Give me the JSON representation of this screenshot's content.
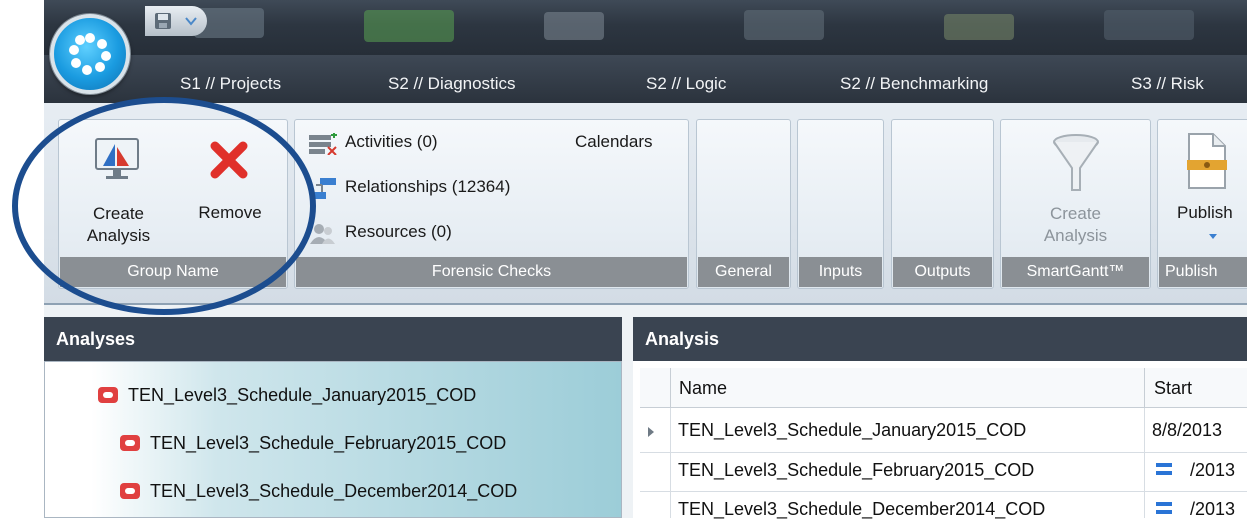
{
  "tabs": [
    "S1 // Projects",
    "S2 // Diagnostics",
    "S2 // Logic",
    "S2 // Benchmarking",
    "S3 // Risk"
  ],
  "ribbon": {
    "group_name": {
      "create_label": "Create\nAnalysis",
      "remove_label": "Remove",
      "label": "Group Name"
    },
    "forensic": {
      "activities": "Activities (0)",
      "relationships": "Relationships (12364)",
      "resources": "Resources (0)",
      "calendars": "Calendars",
      "label": "Forensic Checks"
    },
    "general_label": "General",
    "inputs_label": "Inputs",
    "outputs_label": "Outputs",
    "smartgantt": {
      "create_label": "Create\nAnalysis",
      "label": "SmartGantt™"
    },
    "publish": {
      "button_label": "Publish",
      "label": "Publish"
    }
  },
  "analyses_pane": {
    "title": "Analyses",
    "items": [
      "TEN_Level3_Schedule_January2015_COD",
      "TEN_Level3_Schedule_February2015_COD",
      "TEN_Level3_Schedule_December2014_COD"
    ]
  },
  "analysis_pane": {
    "title": "Analysis",
    "columns": [
      "Name",
      "Start"
    ],
    "rows": [
      {
        "name": "TEN_Level3_Schedule_January2015_COD",
        "start": "8/8/2013"
      },
      {
        "name": "TEN_Level3_Schedule_February2015_COD",
        "start": "/2013"
      },
      {
        "name": "TEN_Level3_Schedule_December2014_COD",
        "start": "/2013"
      }
    ]
  },
  "icons": [
    "app-orb-icon",
    "save-icon",
    "dropdown-arrow-icon",
    "create-analysis-icon",
    "remove-x-icon",
    "activities-icon",
    "relationships-icon",
    "resources-icon",
    "filter-funnel-icon",
    "publish-document-icon",
    "database-icon",
    "row-pointer-icon",
    "task-bar-icon"
  ],
  "colors": {
    "accent_circle": "#1c4d8f",
    "remove_red": "#e0302a",
    "pane_header": "#3a4451"
  }
}
